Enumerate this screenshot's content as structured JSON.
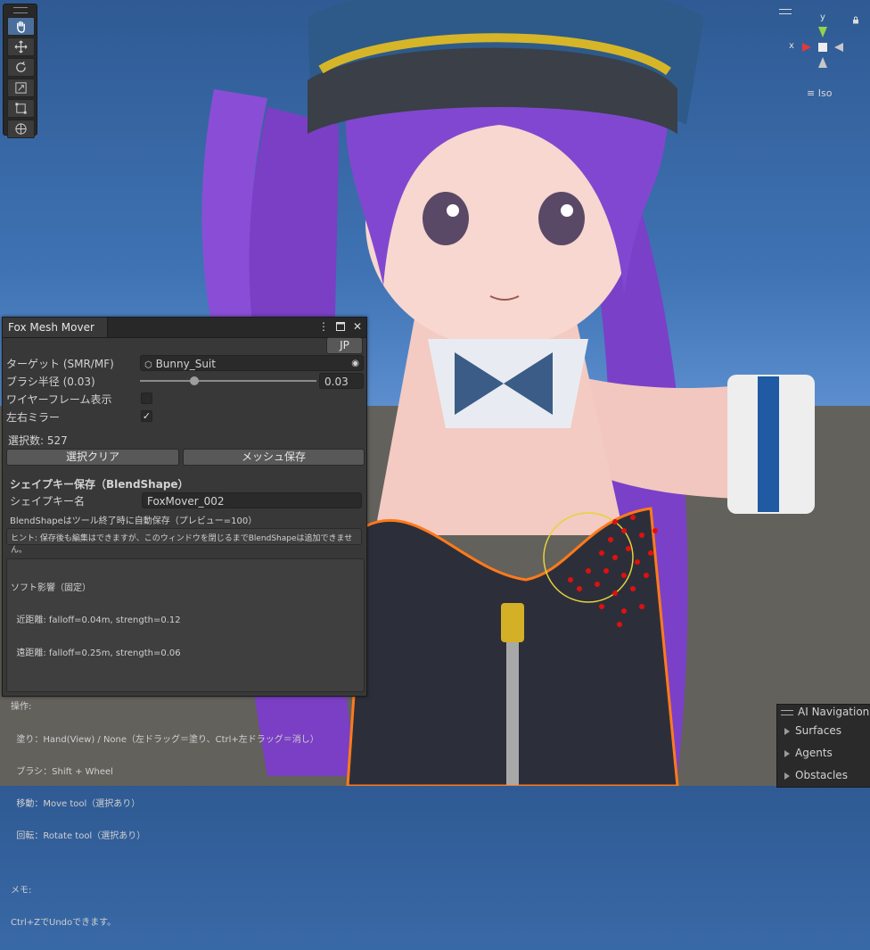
{
  "window": {
    "tab_title": "Fox Mesh Mover",
    "lang_button": "JP",
    "target_label": "ターゲット (SMR/MF)",
    "target_value": "Bunny_Suit",
    "brush_radius_label": "ブラシ半径 (0.03)",
    "brush_radius_value": "0.03",
    "brush_radius_fraction": 0.3,
    "wireframe_label": "ワイヤーフレーム表示",
    "wireframe_checked": false,
    "mirror_label": "左右ミラー",
    "mirror_checked": true,
    "mirror_check_glyph": "✓",
    "selected_count": "選択数: 527",
    "clear_selection_button": "選択クリア",
    "save_mesh_button": "メッシュ保存",
    "shapekey_section_title": "シェイプキー保存（BlendShape）",
    "shapekey_name_label": "シェイプキー名",
    "shapekey_name_value": "FoxMover_002",
    "autosave_note": "BlendShapeはツール終了時に自動保存（プレビュー=100）",
    "hint": "ヒント: 保存後も編集はできますが、このウィンドウを閉じるまでBlendShapeは追加できません。",
    "info_lines": [
      "ソフト影響（固定）",
      "  近距離: falloff=0.04m, strength=0.12",
      "  遠距離: falloff=0.25m, strength=0.06",
      "",
      "操作:",
      "  塗り：Hand(View) / None（左ドラッグ＝塗り、Ctrl+左ドラッグ＝消し）",
      "  ブラシ：Shift + Wheel",
      "  移動：Move tool（選択あり）",
      "  回転：Rotate tool（選択あり）",
      "",
      "メモ:",
      "Ctrl+ZでUndoできます。"
    ]
  },
  "gizmo": {
    "y_label": "y",
    "x_label": "x",
    "projection_label": "Iso"
  },
  "ai_navigation": {
    "title": "AI Navigation",
    "items": [
      "Surfaces",
      "Agents",
      "Obstacles"
    ]
  },
  "colors": {
    "accent": "#4a6f9c",
    "selection_red": "#e01010",
    "brush_yellow": "#e6d23c",
    "outline_orange": "#ff7a1a"
  }
}
